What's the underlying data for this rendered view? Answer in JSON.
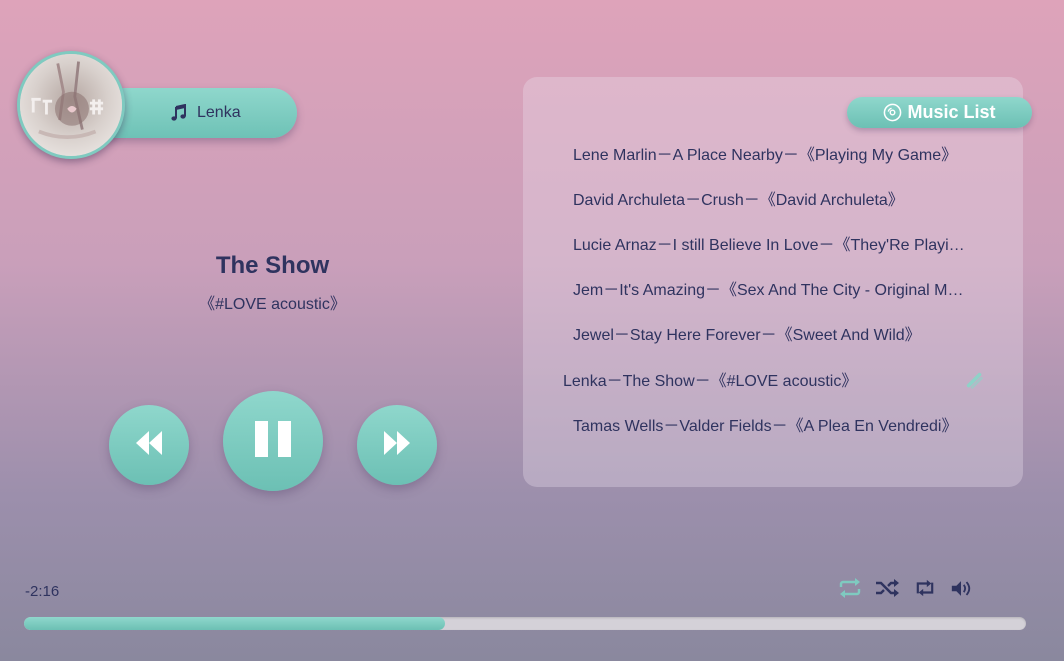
{
  "artist": {
    "name": "Lenka",
    "note_icon": "music-note-icon"
  },
  "now_playing": {
    "title": "The Show",
    "album": "《#LOVE acoustic》"
  },
  "playlist": {
    "header": "Music List",
    "tracks": [
      {
        "text": "Lene Marlin－A Place Nearby－《Playing My Game》",
        "active": false
      },
      {
        "text": "David Archuleta－Crush－《David Archuleta》",
        "active": false
      },
      {
        "text": "Lucie Arnaz－I still Believe In Love－《They'Re Playing Our Song - Original Broadway Cast》",
        "active": false
      },
      {
        "text": "Jem－It's Amazing－《Sex And The City - Original Motion Picture Soundtrack》",
        "active": false
      },
      {
        "text": "Jewel－Stay Here Forever－《Sweet And Wild》",
        "active": false
      },
      {
        "text": "Lenka－The Show－《#LOVE acoustic》",
        "active": true
      },
      {
        "text": "Tamas Wells－Valder Fields－《A Plea En Vendredi》",
        "active": false
      }
    ]
  },
  "player": {
    "remaining_time": "-2:16",
    "progress": 0.42,
    "modes": [
      "repeat-list-icon",
      "shuffle-icon",
      "repeat-one-icon",
      "volume-icon"
    ]
  },
  "colors": {
    "accent": "#7fcac0",
    "text": "#2f335f",
    "track_bg": "#d4d1d8"
  }
}
